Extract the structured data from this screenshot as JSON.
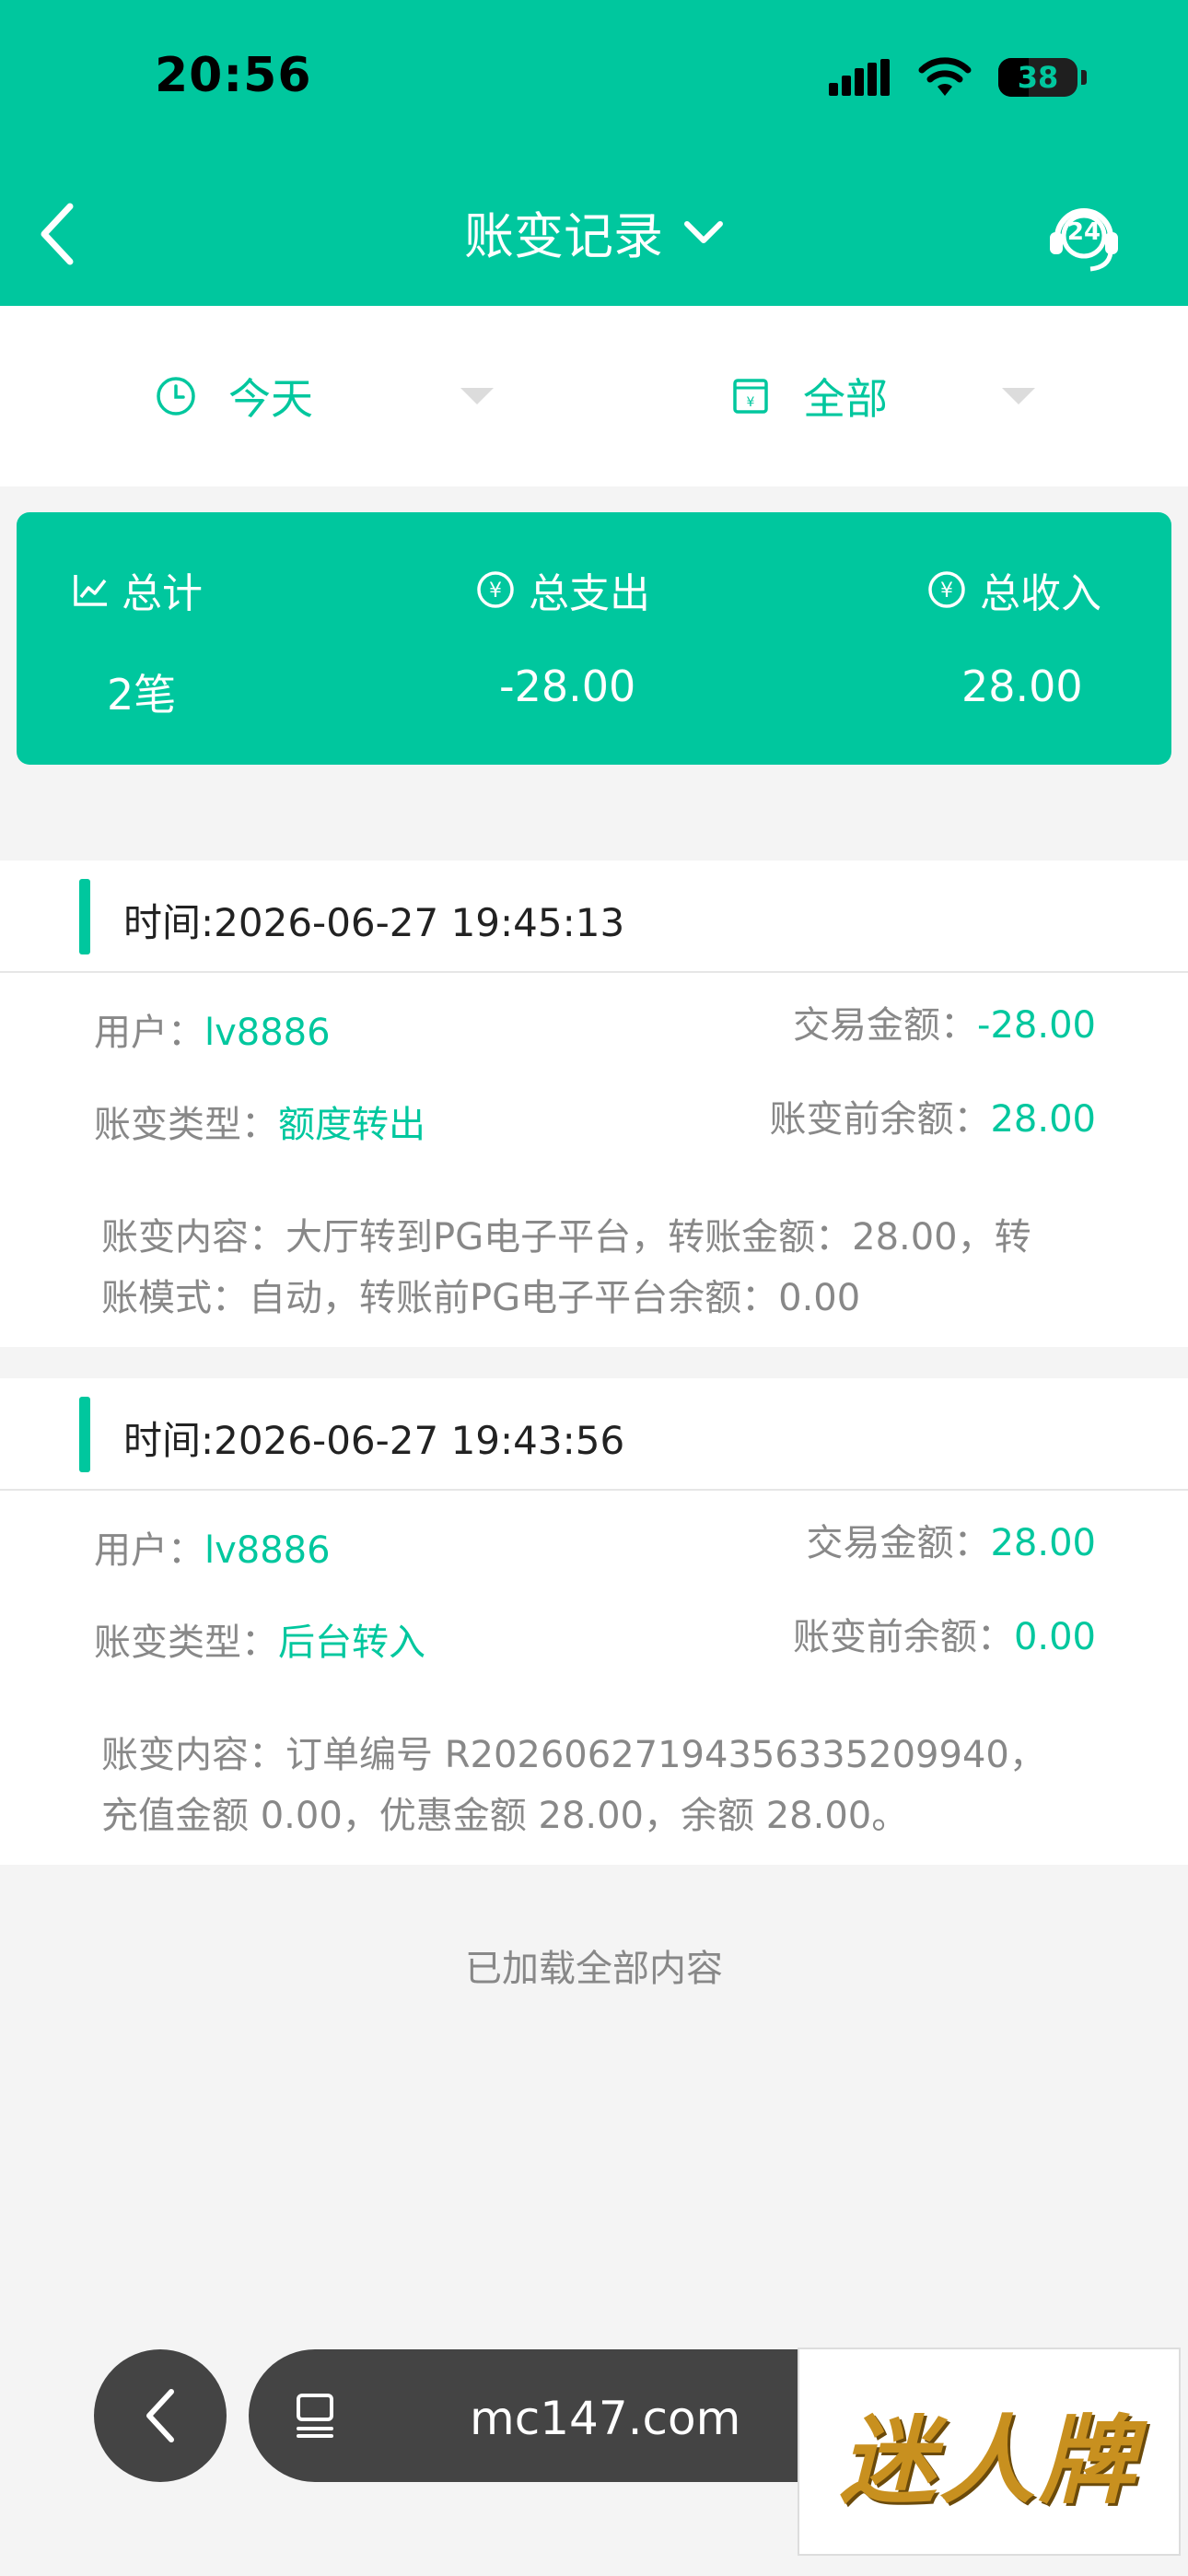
{
  "status_bar": {
    "time": "20:56",
    "battery": "38"
  },
  "header": {
    "title": "账变记录",
    "support_badge": "24"
  },
  "filters": {
    "date": "今天",
    "type": "全部"
  },
  "summary": {
    "total_label": "总计",
    "total_value": "2笔",
    "expense_label": "总支出",
    "expense_value": "-28.00",
    "income_label": "总收入",
    "income_value": "28.00"
  },
  "records": [
    {
      "time": "时间:2026-06-27 19:45:13",
      "user_label": "用户：",
      "user": "lv8886",
      "amount_label": "交易金额：",
      "amount": "-28.00",
      "type_label": "账变类型：",
      "type": "额度转出",
      "balance_label": "账变前余额：",
      "balance": "28.00",
      "content_line1": "账变内容：大厅转到PG电子平台，转账金额：28.00，转",
      "content_line2": "账模式：自动，转账前PG电子平台余额：0.00"
    },
    {
      "time": "时间:2026-06-27 19:43:56",
      "user_label": "用户：",
      "user": "lv8886",
      "amount_label": "交易金额：",
      "amount": "28.00",
      "type_label": "账变类型：",
      "type": "后台转入",
      "balance_label": "账变前余额：",
      "balance": "0.00",
      "content_line1": "账变内容：订单编号 R20260627194356335209940，",
      "content_line2": "充值金额 0.00，优惠金额 28.00，余额 28.00。"
    }
  ],
  "footer_note": "已加载全部内容",
  "browser": {
    "url": "mc147.com"
  },
  "watermark": "迷人牌",
  "colors": {
    "accent": "#00c79e",
    "background": "#f4f4f4"
  }
}
